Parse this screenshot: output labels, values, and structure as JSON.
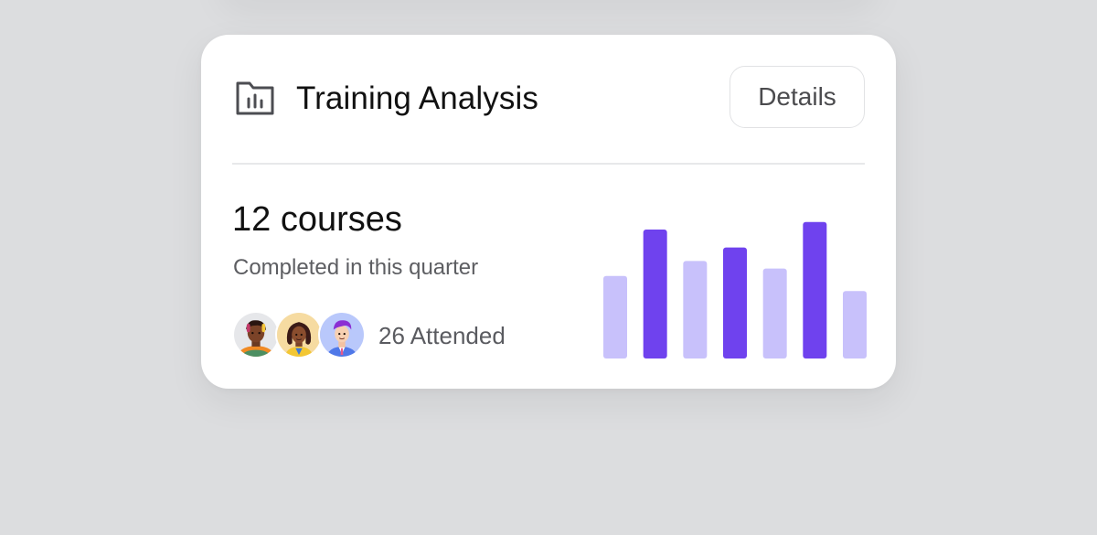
{
  "card": {
    "title": "Training Analysis",
    "header_icon": "folder-chart-icon",
    "details_label": "Details",
    "metric": "12 courses",
    "subtitle": "Completed in this quarter",
    "attended_label": "26 Attended",
    "avatars": [
      "avatar-1",
      "avatar-2",
      "avatar-3"
    ]
  },
  "colors": {
    "background": "#dcdddf",
    "card": "#ffffff",
    "accent_dark": "#6f42ee",
    "accent_light": "#c8c1fb",
    "text_primary": "#111111",
    "text_secondary": "#5d5e62"
  },
  "chart_data": {
    "type": "bar",
    "values": [
      55,
      86,
      65,
      74,
      60,
      91,
      45
    ],
    "highlight": [
      false,
      true,
      false,
      true,
      false,
      true,
      false
    ],
    "ylim": [
      0,
      100
    ],
    "grid": false,
    "title": "",
    "xlabel": "",
    "ylabel": ""
  }
}
